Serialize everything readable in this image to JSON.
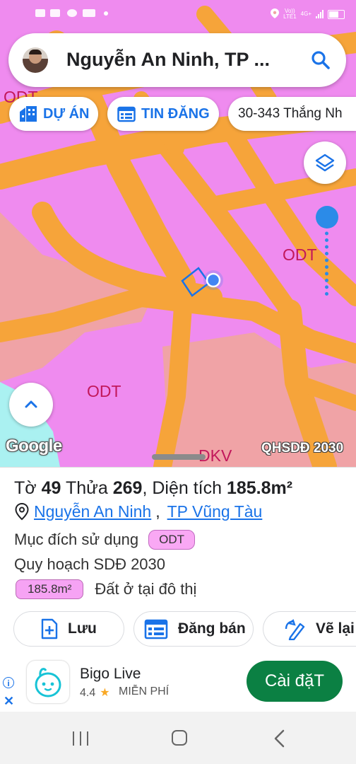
{
  "status_bar": {
    "network_top": "Vo))",
    "network_bottom": "LTE1",
    "network_type": "4G+"
  },
  "search": {
    "query": "Nguyễn An Ninh, TP ...",
    "icon": "search-icon"
  },
  "chips": [
    {
      "label": "DỰ ÁN",
      "icon": "building-icon"
    },
    {
      "label": "TIN ĐĂNG",
      "icon": "listing-icon"
    },
    {
      "label": "30-343 Thắng Nh"
    }
  ],
  "map": {
    "labels": [
      "ODT",
      "ODT",
      "ODT",
      "DKV"
    ],
    "provider": "Google",
    "overlay_label": "QHSDĐ 2030",
    "colors": {
      "zone_pink": "#ef8bef",
      "road_orange": "#f6a43a",
      "light_pink": "#f0a3a6",
      "water_cyan": "#aaf1f1",
      "location_blue": "#4285f4"
    }
  },
  "info": {
    "title_prefix": "Tờ",
    "sheet_no": "49",
    "parcel_label": "Thửa",
    "parcel_no": "269",
    "area_label": ", Diện tích",
    "area": "185.8m²",
    "street": "Nguyễn An Ninh",
    "city": "TP Vũng Tàu",
    "purpose_label": "Mục đích sử dụng",
    "purpose_code": "ODT",
    "plan_label": "Quy hoạch SDĐ 2030",
    "plan_area": "185.8m²",
    "plan_use": "Đất ở tại đô thị"
  },
  "actions": [
    {
      "label": "Lưu",
      "icon": "save-add-icon"
    },
    {
      "label": "Đăng bán",
      "icon": "listing-icon"
    },
    {
      "label": "Vẽ lại",
      "icon": "edit-pen-icon"
    }
  ],
  "ad": {
    "app_name": "Bigo Live",
    "rating": "4.4",
    "price": "MIỄN PHÍ",
    "install_label": "Cài đặT",
    "info_glyph": "i",
    "close_glyph": "✕"
  }
}
